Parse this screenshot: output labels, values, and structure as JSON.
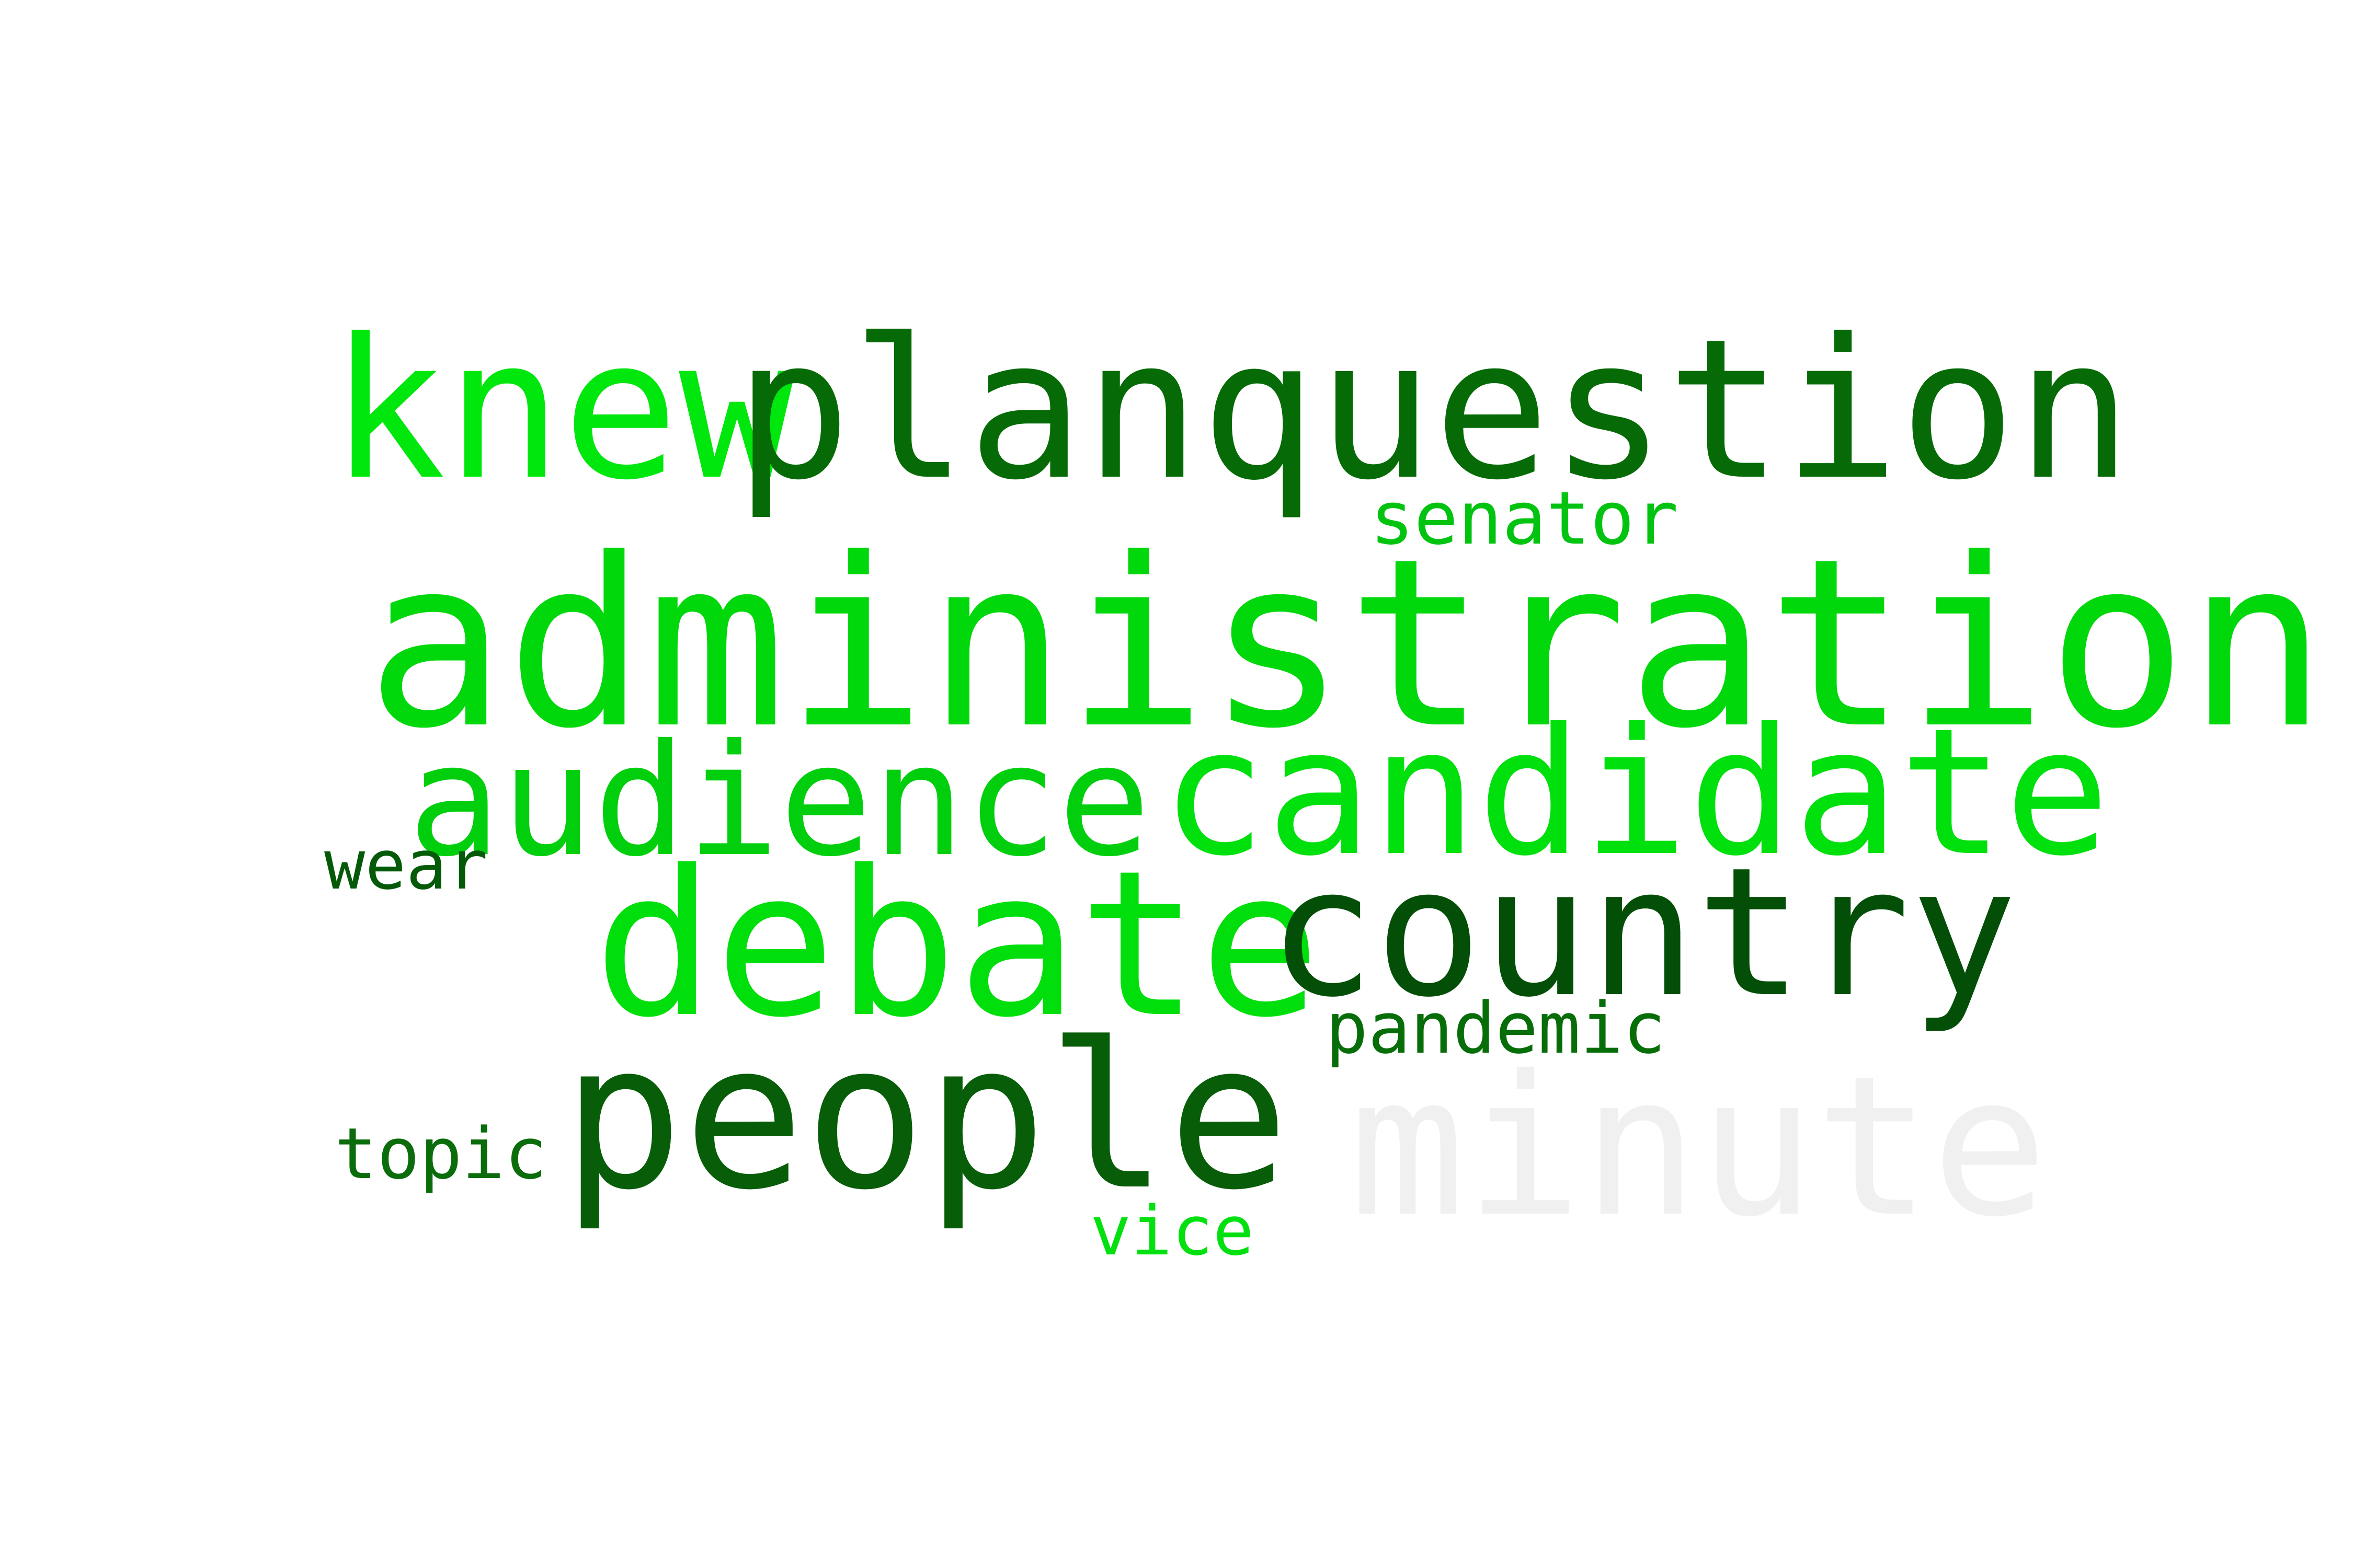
{
  "words": [
    {
      "text": "knew",
      "color": "#00e70e"
    },
    {
      "text": "planquestion",
      "color": "#066b06"
    },
    {
      "text": "senator",
      "color": "#02c410"
    },
    {
      "text": "administration",
      "color": "#00d80c"
    },
    {
      "text": "audience",
      "color": "#01cf0d"
    },
    {
      "text": "candidate",
      "color": "#00e00d"
    },
    {
      "text": "wear",
      "color": "#045a08"
    },
    {
      "text": "debate",
      "color": "#00df0b"
    },
    {
      "text": "country",
      "color": "#044f07"
    },
    {
      "text": "pandemic",
      "color": "#066d08"
    },
    {
      "text": "topic",
      "color": "#0a6c0a"
    },
    {
      "text": "people",
      "color": "#085d08"
    },
    {
      "text": "minute",
      "color": "#f0f0f0"
    },
    {
      "text": "vice",
      "color": "#03e00f"
    }
  ]
}
